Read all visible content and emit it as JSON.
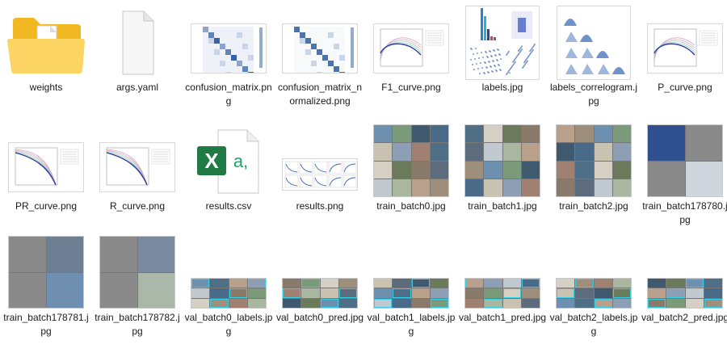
{
  "files": [
    {
      "name": "weights",
      "kind": "folder",
      "icon": "folder-icon"
    },
    {
      "name": "args.yaml",
      "kind": "yaml",
      "icon": "document-icon"
    },
    {
      "name": "confusion_matrix.png",
      "kind": "confusion",
      "icon": "image-thumbnail"
    },
    {
      "name": "confusion_matrix_normalized.png",
      "kind": "confusion_norm",
      "icon": "image-thumbnail"
    },
    {
      "name": "F1_curve.png",
      "kind": "curve",
      "icon": "image-thumbnail"
    },
    {
      "name": "labels.jpg",
      "kind": "labels",
      "icon": "image-thumbnail"
    },
    {
      "name": "labels_correlogram.jpg",
      "kind": "correlogram",
      "icon": "image-thumbnail"
    },
    {
      "name": "P_curve.png",
      "kind": "curve",
      "icon": "image-thumbnail"
    },
    {
      "name": "PR_curve.png",
      "kind": "curve_down",
      "icon": "image-thumbnail"
    },
    {
      "name": "R_curve.png",
      "kind": "curve_down",
      "icon": "image-thumbnail"
    },
    {
      "name": "results.csv",
      "kind": "excel",
      "icon": "excel-icon"
    },
    {
      "name": "results.png",
      "kind": "results",
      "icon": "image-thumbnail"
    },
    {
      "name": "train_batch0.jpg",
      "kind": "batch",
      "icon": "image-thumbnail"
    },
    {
      "name": "train_batch1.jpg",
      "kind": "batch",
      "icon": "image-thumbnail"
    },
    {
      "name": "train_batch2.jpg",
      "kind": "batch",
      "icon": "image-thumbnail"
    },
    {
      "name": "train_batch178780.jpg",
      "kind": "batch_gray",
      "icon": "image-thumbnail"
    },
    {
      "name": "train_batch178781.jpg",
      "kind": "batch_gray",
      "icon": "image-thumbnail"
    },
    {
      "name": "train_batch178782.jpg",
      "kind": "batch_gray",
      "icon": "image-thumbnail"
    },
    {
      "name": "val_batch0_labels.jpg",
      "kind": "val",
      "icon": "image-thumbnail"
    },
    {
      "name": "val_batch0_pred.jpg",
      "kind": "val",
      "icon": "image-thumbnail"
    },
    {
      "name": "val_batch1_labels.jpg",
      "kind": "val",
      "icon": "image-thumbnail"
    },
    {
      "name": "val_batch1_pred.jpg",
      "kind": "val",
      "icon": "image-thumbnail"
    },
    {
      "name": "val_batch2_labels.jpg",
      "kind": "val",
      "icon": "image-thumbnail"
    },
    {
      "name": "val_batch2_pred.jpg",
      "kind": "val",
      "icon": "image-thumbnail"
    }
  ],
  "excel_icon_letters": {
    "x": "X",
    "a": "a,"
  },
  "colors": {
    "folder": "#f2b824",
    "folder_light": "#fcd463",
    "excel": "#1f7a43",
    "excel_text": "#21a366",
    "thumb_blue": "#2c5aa0"
  }
}
